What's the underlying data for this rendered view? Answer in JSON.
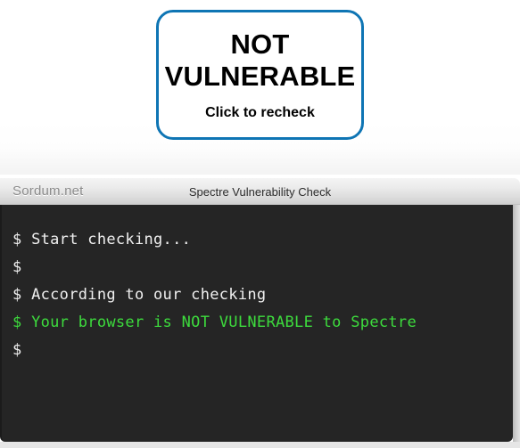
{
  "colors": {
    "accent_border": "#0e75b4",
    "console_background": "#252525",
    "console_text": "#f0f0f0",
    "console_success_text": "#3ddb3d",
    "titlebar_brand_text": "#8b8b8b",
    "titlebar_title_text": "#2c2c2c",
    "page_background": "#ffffff"
  },
  "status_button": {
    "headline": "NOT\nVULNERABLE",
    "subtext": "Click to recheck"
  },
  "console": {
    "titlebar": {
      "brand": "Sordum.net",
      "title": "Spectre Vulnerability Check"
    },
    "lines": [
      {
        "text": "$ Start checking...",
        "style": "normal"
      },
      {
        "text": "$",
        "style": "normal"
      },
      {
        "text": "$ According to our checking",
        "style": "normal"
      },
      {
        "text": "$ Your browser is NOT VULNERABLE to Spectre",
        "style": "success"
      },
      {
        "text": "$",
        "style": "normal"
      }
    ]
  }
}
